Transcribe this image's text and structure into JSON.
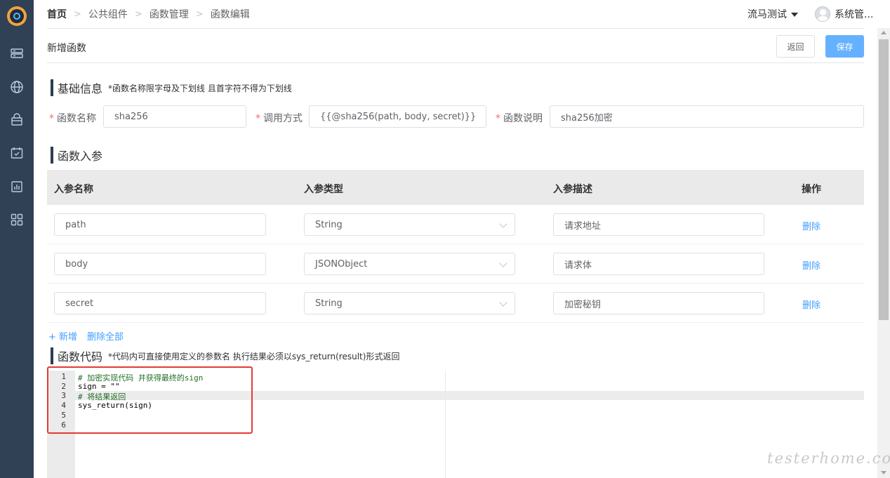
{
  "breadcrumb": [
    "首页",
    "公共组件",
    "函数管理",
    "函数编辑"
  ],
  "header": {
    "environment": "流马测试",
    "user": "系统管..."
  },
  "page": {
    "title": "新增函数",
    "back_label": "返回",
    "save_label": "保存"
  },
  "basic_info": {
    "title": "基础信息",
    "note": "*函数名称限字母及下划线 且首字符不得为下划线",
    "fields": [
      {
        "label": "函数名称",
        "value": "sha256"
      },
      {
        "label": "调用方式",
        "value": "{{@sha256(path, body, secret)}}"
      },
      {
        "label": "函数说明",
        "value": "sha256加密"
      }
    ]
  },
  "params": {
    "title": "函数入参",
    "headers": [
      "入参名称",
      "入参类型",
      "入参描述",
      "操作"
    ],
    "rows": [
      {
        "name": "path",
        "type": "String",
        "desc": "请求地址",
        "action": "删除"
      },
      {
        "name": "body",
        "type": "JSONObject",
        "desc": "请求体",
        "action": "删除"
      },
      {
        "name": "secret",
        "type": "String",
        "desc": "加密秘钥",
        "action": "删除"
      }
    ],
    "add_label": "+ 新增",
    "delete_all_label": "删除全部"
  },
  "code": {
    "title": "函数代码",
    "note": "*代码内可直接使用定义的参数名 执行结果必须以sys_return(result)形式返回",
    "line_numbers": [
      "1",
      "2",
      "3",
      "4",
      "5",
      "6"
    ],
    "lines": [
      "# 加密实现代码 并获得最终的sign",
      "sign = \"\"",
      "# 将结果返回",
      "sys_return(sign)",
      "",
      ""
    ],
    "active_line": 3
  },
  "watermark": "testerhome.com",
  "colors": {
    "sidebar": "#304156",
    "primary": "#409eff",
    "save_button": "#66b1ff",
    "required": "#f56c6c",
    "highlight_box": "#e53935"
  },
  "icons": [
    "logo-icon",
    "server-icon",
    "globe-icon",
    "package-icon",
    "calendar-check-icon",
    "report-icon",
    "grid-icon",
    "chevron-down-icon",
    "user-avatar-icon"
  ]
}
